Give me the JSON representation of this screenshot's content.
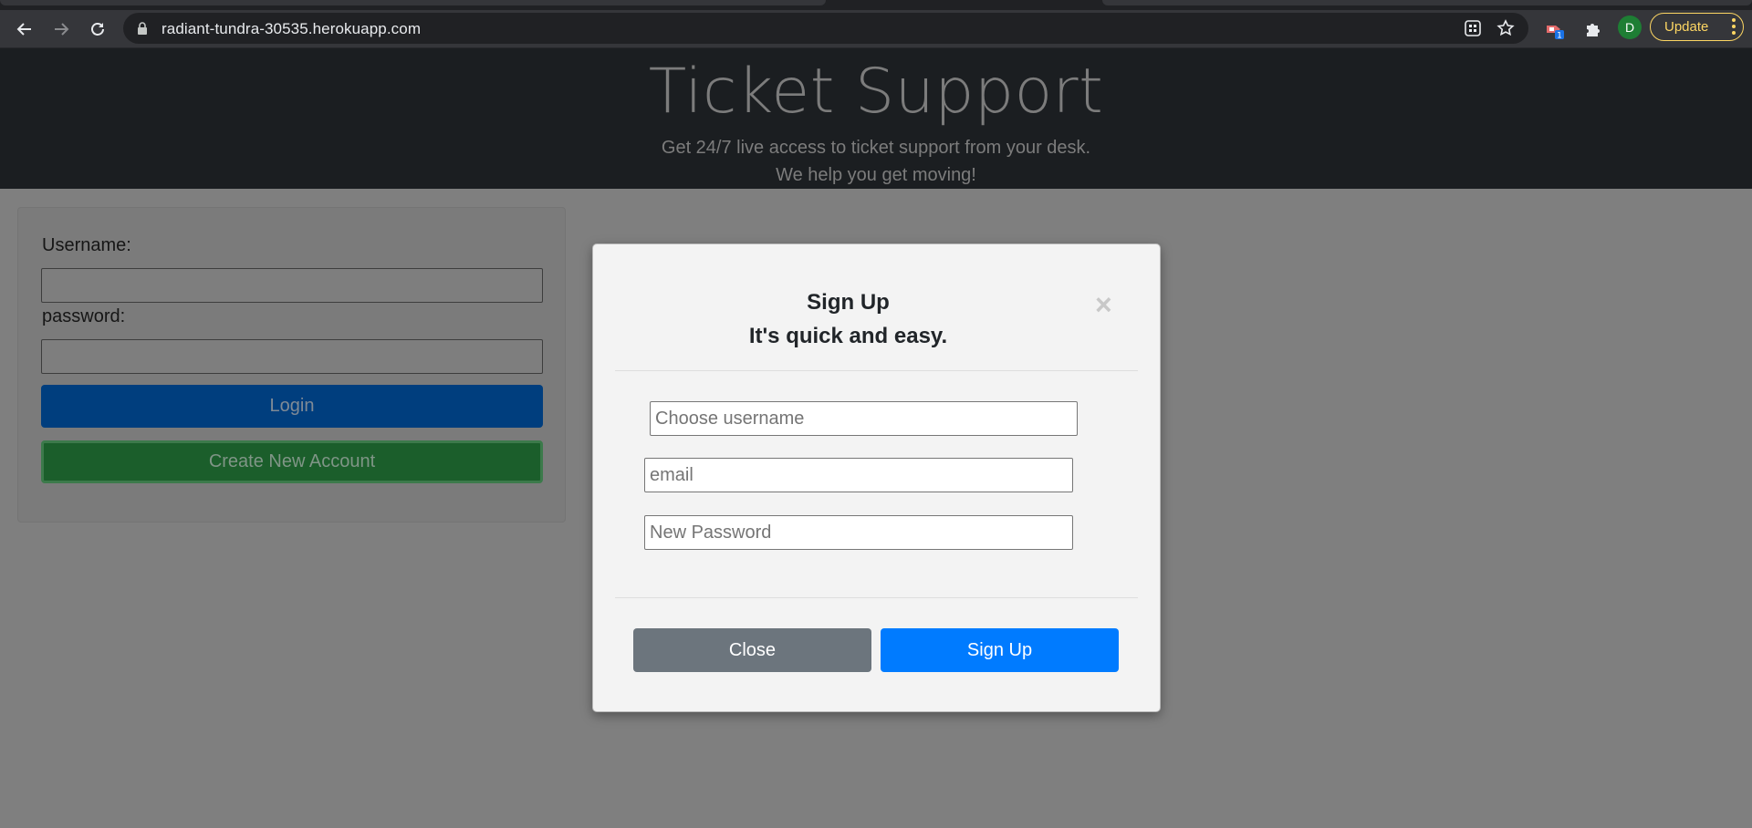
{
  "browser": {
    "url": "radiant-tundra-30535.herokuapp.com",
    "profile_initial": "D",
    "update_label": "Update",
    "extension_badge": "1",
    "icons": [
      "back-icon",
      "forward-icon",
      "reload-icon",
      "lock-icon",
      "qr-code-icon",
      "star-icon",
      "extension-icon",
      "puzzle-icon",
      "menu-dots-icon"
    ],
    "colors": {
      "chrome": "#35363a",
      "omnibox": "#202124",
      "update_accent": "#fdd663",
      "avatar": "#1e7e34"
    }
  },
  "hero": {
    "title": "Ticket Support",
    "subtitle_line1": "Get 24/7 live access to ticket support from your desk.",
    "subtitle_line2": "We help you get moving!"
  },
  "login": {
    "username_label": "Username:",
    "username_value": "",
    "password_label": "password:",
    "password_value": "",
    "login_button": "Login",
    "create_button": "Create New Account"
  },
  "modal": {
    "title": "Sign Up",
    "subtitle": "It's quick and easy.",
    "close_symbol": "×",
    "username_placeholder": "Choose username",
    "email_placeholder": "email",
    "password_placeholder": "New Password",
    "close_button": "Close",
    "signup_button": "Sign Up",
    "colors": {
      "close_button": "#6c757d",
      "signup_button": "#007bff"
    }
  }
}
